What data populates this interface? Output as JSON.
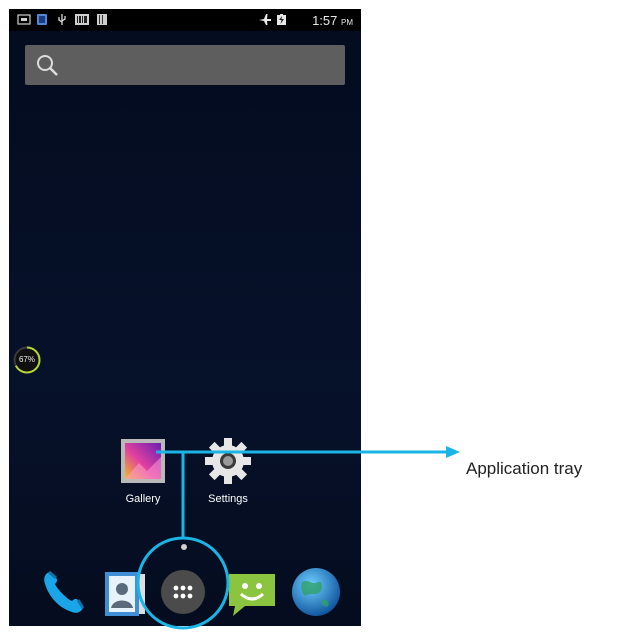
{
  "status_bar": {
    "time": "1:57",
    "ampm": "PM",
    "icons": [
      "sim-card-icon",
      "notification-icon",
      "usb-icon",
      "barcode-icon",
      "storage-icon",
      "airplane-mode-icon",
      "battery-charging-icon"
    ]
  },
  "search": {
    "icon": "search-icon"
  },
  "battery_widget": {
    "label": "67%",
    "level": 0.67
  },
  "home_apps": [
    {
      "label": "Gallery",
      "icon": "gallery-icon"
    },
    {
      "label": "Settings",
      "icon": "settings-gear-icon"
    }
  ],
  "dock": [
    {
      "icon": "phone-icon"
    },
    {
      "icon": "contacts-icon"
    },
    {
      "icon": "app-drawer-icon"
    },
    {
      "icon": "messaging-icon"
    },
    {
      "icon": "browser-globe-icon"
    }
  ],
  "callout": {
    "label": "Application tray",
    "color": "#1ab5e6"
  }
}
